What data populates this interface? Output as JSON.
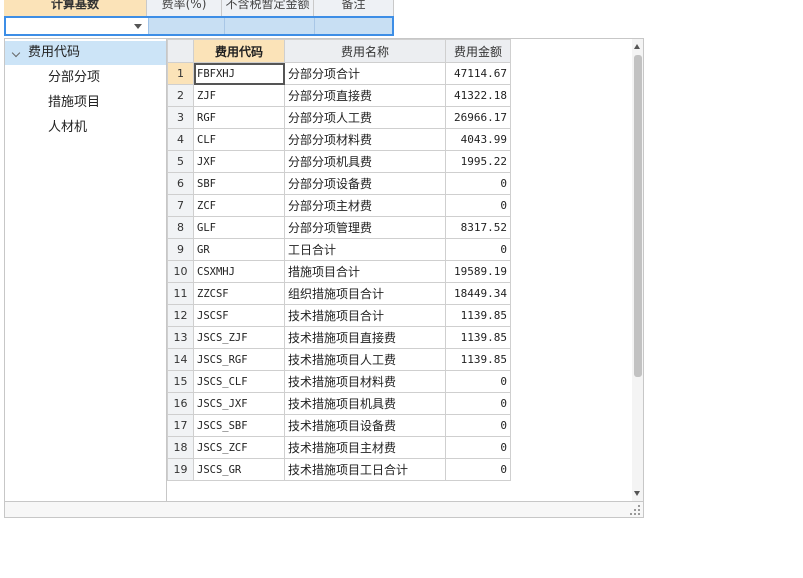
{
  "top_header": {
    "columns": [
      "计算基数",
      "费率(%)",
      "不含税暂定金额",
      "备注"
    ]
  },
  "tree": {
    "root": "费用代码",
    "children": [
      "分部分项",
      "措施项目",
      "人材机"
    ]
  },
  "grid": {
    "columns": [
      "",
      "费用代码",
      "费用名称",
      "费用金额"
    ],
    "rows": [
      {
        "n": "1",
        "code": "FBFXHJ",
        "name": "分部分项合计",
        "amount": "47114.67"
      },
      {
        "n": "2",
        "code": "ZJF",
        "name": "分部分项直接费",
        "amount": "41322.18"
      },
      {
        "n": "3",
        "code": "RGF",
        "name": "分部分项人工费",
        "amount": "26966.17"
      },
      {
        "n": "4",
        "code": "CLF",
        "name": "分部分项材料费",
        "amount": "4043.99"
      },
      {
        "n": "5",
        "code": "JXF",
        "name": "分部分项机具费",
        "amount": "1995.22"
      },
      {
        "n": "6",
        "code": "SBF",
        "name": "分部分项设备费",
        "amount": "0"
      },
      {
        "n": "7",
        "code": "ZCF",
        "name": "分部分项主材费",
        "amount": "0"
      },
      {
        "n": "8",
        "code": "GLF",
        "name": "分部分项管理费",
        "amount": "8317.52"
      },
      {
        "n": "9",
        "code": "GR",
        "name": "工日合计",
        "amount": "0"
      },
      {
        "n": "10",
        "code": "CSXMHJ",
        "name": "措施项目合计",
        "amount": "19589.19"
      },
      {
        "n": "11",
        "code": "ZZCSF",
        "name": "组织措施项目合计",
        "amount": "18449.34"
      },
      {
        "n": "12",
        "code": "JSCSF",
        "name": "技术措施项目合计",
        "amount": "1139.85"
      },
      {
        "n": "13",
        "code": "JSCS_ZJF",
        "name": "技术措施项目直接费",
        "amount": "1139.85"
      },
      {
        "n": "14",
        "code": "JSCS_RGF",
        "name": "技术措施项目人工费",
        "amount": "1139.85"
      },
      {
        "n": "15",
        "code": "JSCS_CLF",
        "name": "技术措施项目材料费",
        "amount": "0"
      },
      {
        "n": "16",
        "code": "JSCS_JXF",
        "name": "技术措施项目机具费",
        "amount": "0"
      },
      {
        "n": "17",
        "code": "JSCS_SBF",
        "name": "技术措施项目设备费",
        "amount": "0"
      },
      {
        "n": "18",
        "code": "JSCS_ZCF",
        "name": "技术措施项目主材费",
        "amount": "0"
      },
      {
        "n": "19",
        "code": "JSCS_GR",
        "name": "技术措施项目工日合计",
        "amount": "0"
      }
    ]
  },
  "colors": {
    "header_active": "#fbe3b8",
    "selection_blue": "#cce4f7",
    "edit_border": "#3d8ee6"
  }
}
